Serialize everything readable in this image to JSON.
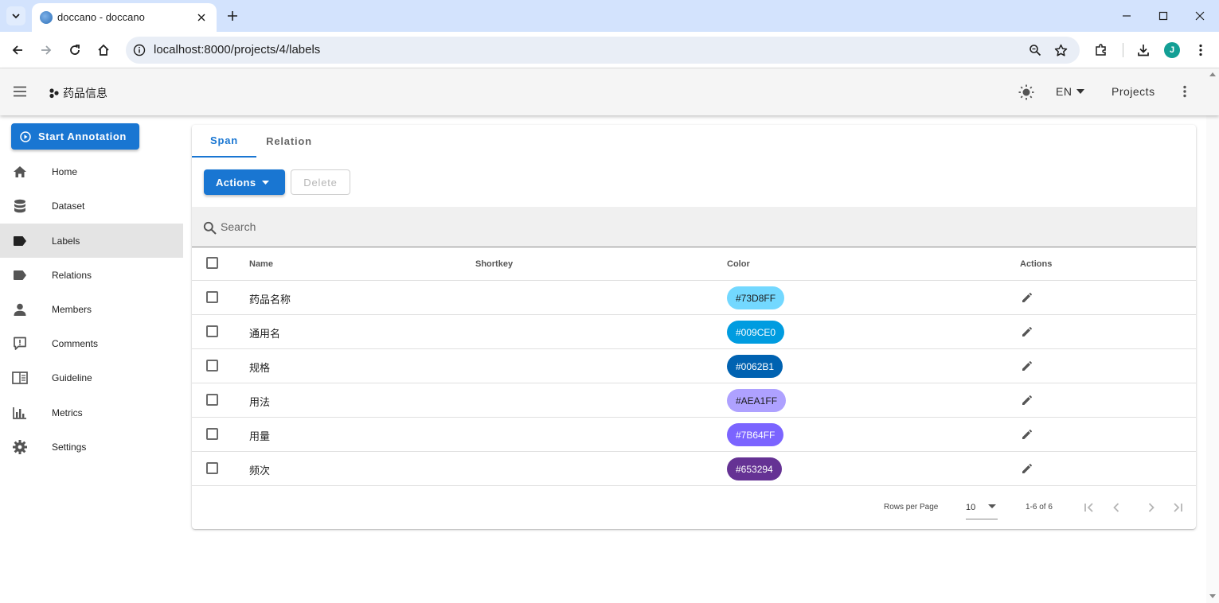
{
  "browser": {
    "tab_title": "doccano - doccano",
    "url": "localhost:8000/projects/4/labels",
    "profile_initial": "J"
  },
  "appbar": {
    "project_name": "药品信息",
    "language": "EN",
    "projects_label": "Projects"
  },
  "sidebar": {
    "start_annotation": "Start Annotation",
    "items": [
      {
        "label": "Home",
        "icon": "home-icon"
      },
      {
        "label": "Dataset",
        "icon": "database-icon"
      },
      {
        "label": "Labels",
        "icon": "label-icon",
        "active": true
      },
      {
        "label": "Relations",
        "icon": "label-outline-icon"
      },
      {
        "label": "Members",
        "icon": "account-icon"
      },
      {
        "label": "Comments",
        "icon": "comment-icon"
      },
      {
        "label": "Guideline",
        "icon": "book-icon"
      },
      {
        "label": "Metrics",
        "icon": "bar-chart-icon"
      },
      {
        "label": "Settings",
        "icon": "gear-icon"
      }
    ]
  },
  "tabs": [
    {
      "label": "Span",
      "active": true
    },
    {
      "label": "Relation",
      "active": false
    }
  ],
  "buttons": {
    "actions": "Actions",
    "delete": "Delete"
  },
  "search": {
    "placeholder": "Search",
    "value": ""
  },
  "table": {
    "headers": {
      "name": "Name",
      "shortkey": "Shortkey",
      "color": "Color",
      "actions": "Actions"
    },
    "rows": [
      {
        "name": "药品名称",
        "shortkey": "",
        "color": "#73D8FF",
        "text_color": "#1a1a1a"
      },
      {
        "name": "通用名",
        "shortkey": "",
        "color": "#009CE0",
        "text_color": "#ffffff"
      },
      {
        "name": "规格",
        "shortkey": "",
        "color": "#0062B1",
        "text_color": "#ffffff"
      },
      {
        "name": "用法",
        "shortkey": "",
        "color": "#AEA1FF",
        "text_color": "#1a1a1a"
      },
      {
        "name": "用量",
        "shortkey": "",
        "color": "#7B64FF",
        "text_color": "#ffffff"
      },
      {
        "name": "频次",
        "shortkey": "",
        "color": "#653294",
        "text_color": "#ffffff"
      }
    ]
  },
  "pagination": {
    "rows_per_page_label": "Rows per Page",
    "rows_per_page": "10",
    "range": "1-6 of 6"
  },
  "colors": {
    "primary": "#1976d2",
    "appbar_bg": "#f5f5f5",
    "tabstrip_bg": "#d3e3fd"
  }
}
